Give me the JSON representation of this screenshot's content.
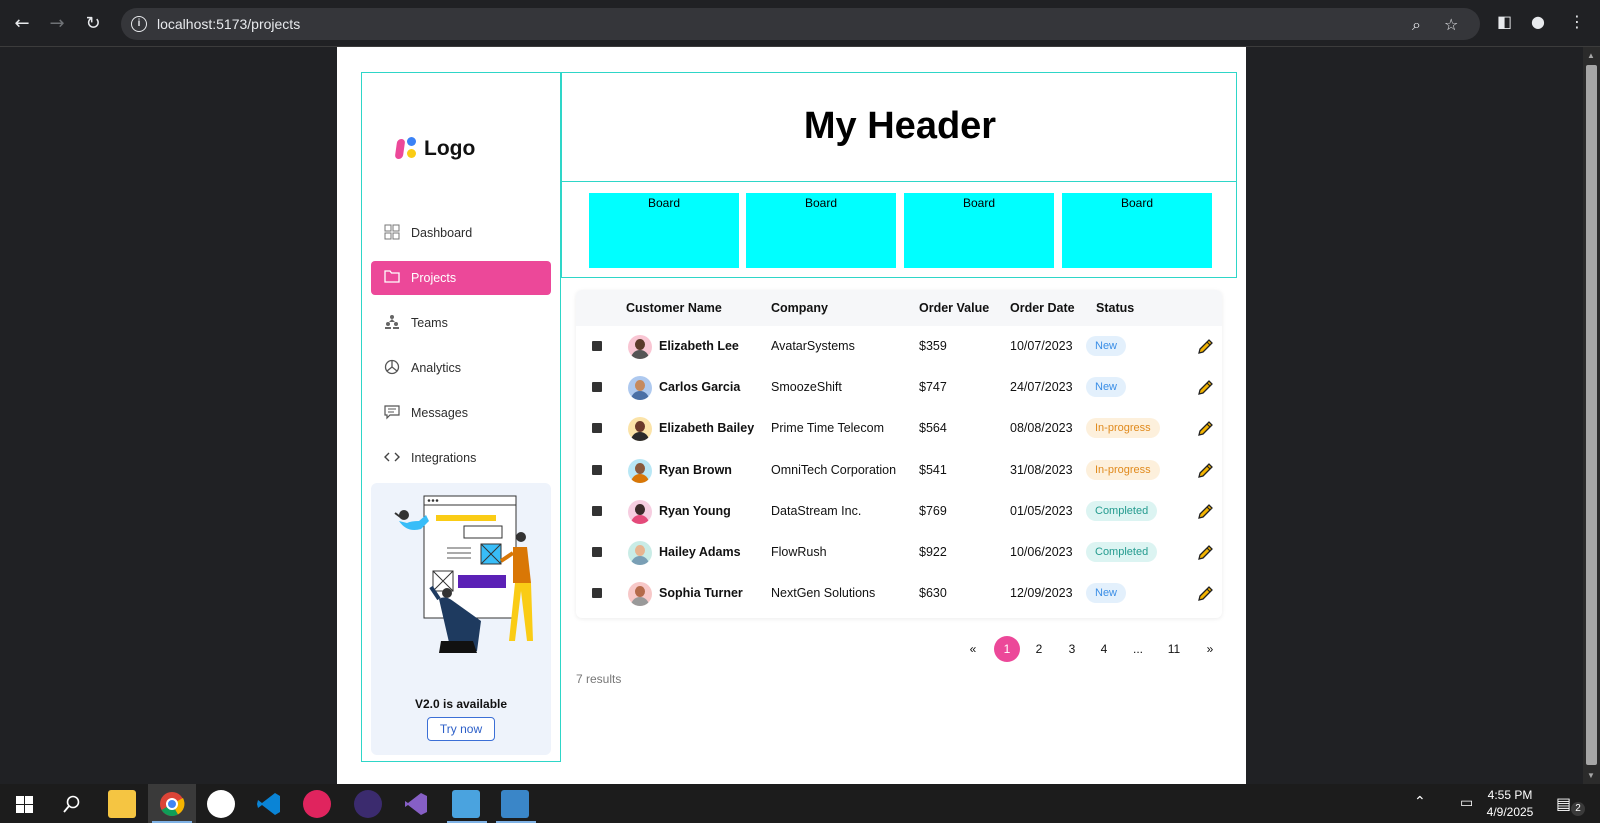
{
  "browser": {
    "url": "localhost:5173/projects",
    "back_icon": "arrow-left-icon",
    "forward_icon": "arrow-right-icon",
    "reload_icon": "reload-icon"
  },
  "sidebar": {
    "logo_text": "Logo",
    "items": [
      {
        "label": "Dashboard",
        "icon": "grid-icon",
        "active": false
      },
      {
        "label": "Projects",
        "icon": "folder-icon",
        "active": true
      },
      {
        "label": "Teams",
        "icon": "team-icon",
        "active": false
      },
      {
        "label": "Analytics",
        "icon": "pie-chart-icon",
        "active": false
      },
      {
        "label": "Messages",
        "icon": "message-icon",
        "active": false
      },
      {
        "label": "Integrations",
        "icon": "code-icon",
        "active": false
      }
    ],
    "promo": {
      "title": "V2.0 is available",
      "button": "Try now"
    }
  },
  "header": {
    "title": "My Header"
  },
  "boards": [
    "Board",
    "Board",
    "Board",
    "Board"
  ],
  "table": {
    "columns": [
      "Customer Name",
      "Company",
      "Order Value",
      "Order Date",
      "Status"
    ],
    "rows": [
      {
        "name": "Elizabeth Lee",
        "company": "AvatarSystems",
        "value": "$359",
        "date": "10/07/2023",
        "status": "New",
        "status_type": "new"
      },
      {
        "name": "Carlos Garcia",
        "company": "SmoozeShift",
        "value": "$747",
        "date": "24/07/2023",
        "status": "New",
        "status_type": "new"
      },
      {
        "name": "Elizabeth Bailey",
        "company": "Prime Time Telecom",
        "value": "$564",
        "date": "08/08/2023",
        "status": "In-progress",
        "status_type": "in-progress"
      },
      {
        "name": "Ryan Brown",
        "company": "OmniTech Corporation",
        "value": "$541",
        "date": "31/08/2023",
        "status": "In-progress",
        "status_type": "in-progress"
      },
      {
        "name": "Ryan Young",
        "company": "DataStream Inc.",
        "value": "$769",
        "date": "01/05/2023",
        "status": "Completed",
        "status_type": "completed"
      },
      {
        "name": "Hailey Adams",
        "company": "FlowRush",
        "value": "$922",
        "date": "10/06/2023",
        "status": "Completed",
        "status_type": "completed"
      },
      {
        "name": "Sophia Turner",
        "company": "NextGen Solutions",
        "value": "$630",
        "date": "12/09/2023",
        "status": "New",
        "status_type": "new"
      }
    ]
  },
  "pagination": {
    "prev": "«",
    "pages": [
      "1",
      "2",
      "3",
      "4",
      "...",
      "11"
    ],
    "next": "»",
    "current": "1"
  },
  "results_text": "7 results",
  "taskbar": {
    "time": "4:55 PM",
    "date": "4/9/2025",
    "notification_count": "2"
  },
  "colors": {
    "accent": "#ec4899",
    "border": "#2ed6c8",
    "board": "#00ffff"
  }
}
